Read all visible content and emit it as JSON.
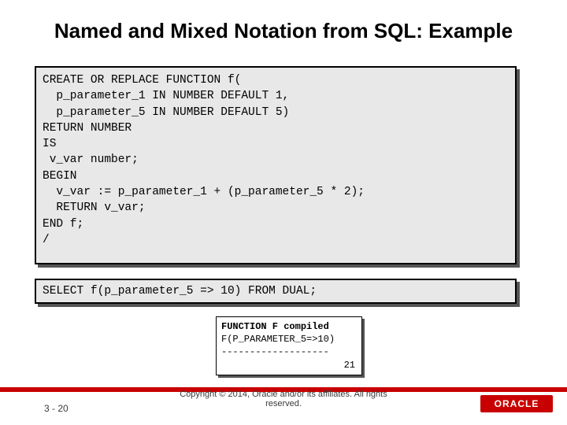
{
  "title": "Named and Mixed Notation from SQL: Example",
  "code1": "CREATE OR REPLACE FUNCTION f(\n  p_parameter_1 IN NUMBER DEFAULT 1,\n  p_parameter_5 IN NUMBER DEFAULT 5)\nRETURN NUMBER\nIS\n v_var number;\nBEGIN\n  v_var := p_parameter_1 + (p_parameter_5 * 2);\n  RETURN v_var;\nEND f;\n/",
  "code2": "SELECT f(p_parameter_5 => 10) FROM DUAL;",
  "result": {
    "line1": "FUNCTION F compiled",
    "line2": "F(P_PARAMETER_5=>10)",
    "line3": "-------------------",
    "line4": "21"
  },
  "footer": {
    "page": "3 - 20",
    "copyright1": "Copyright © 2014, Oracle and/or its affiliates. All rights",
    "copyright2": "reserved.",
    "logo": "ORACLE"
  }
}
